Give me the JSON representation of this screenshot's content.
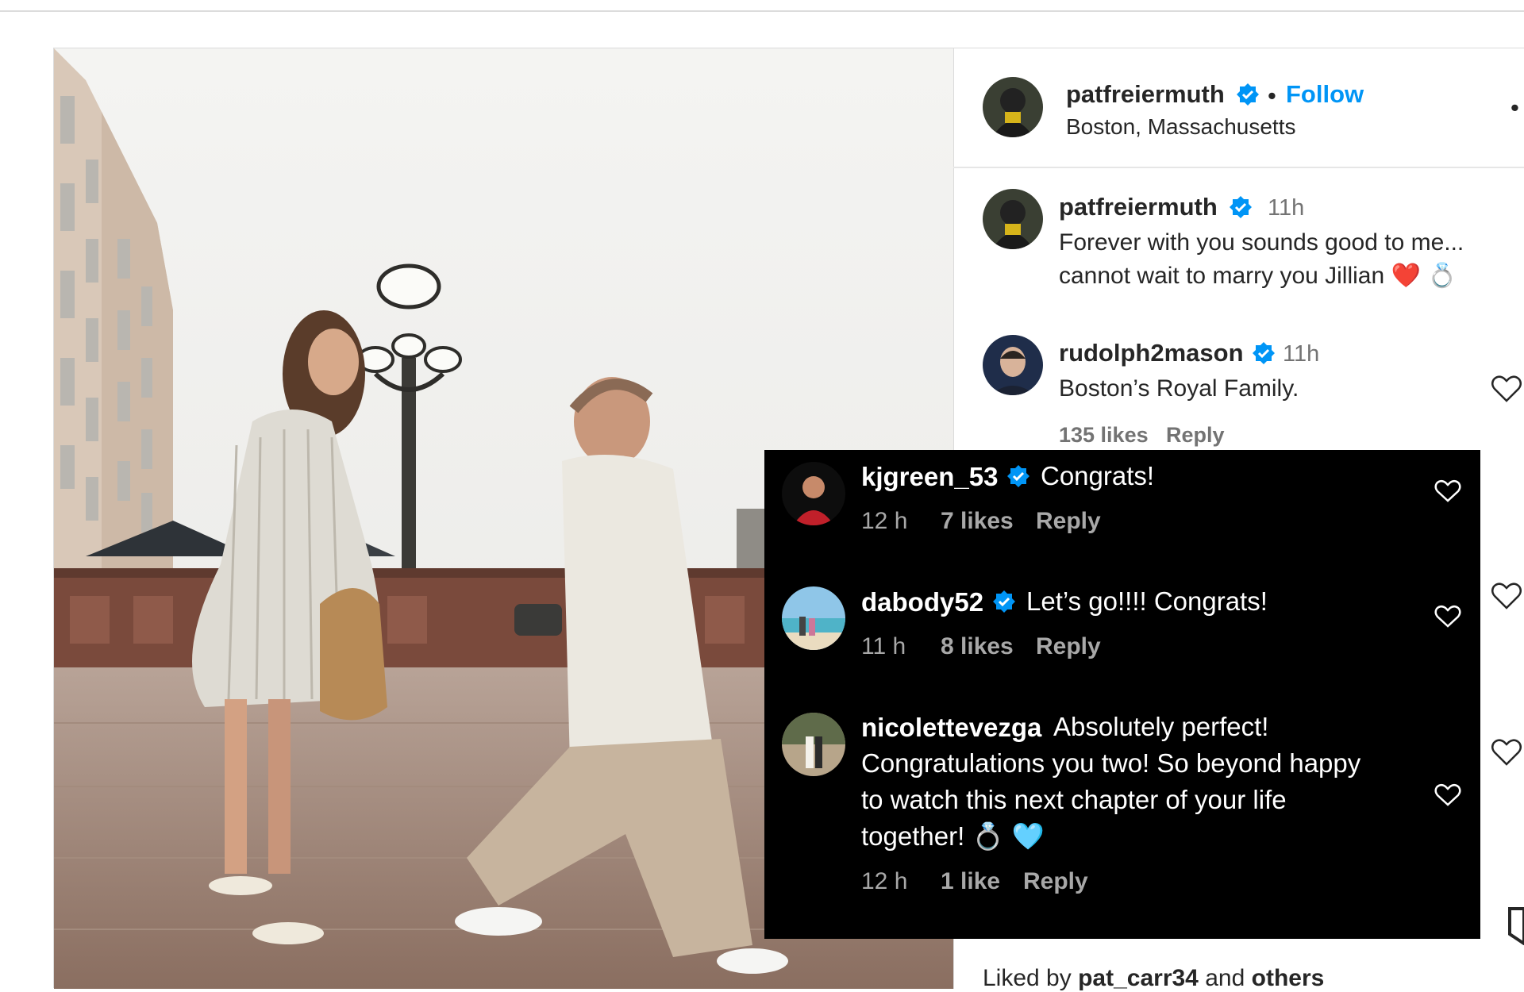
{
  "post": {
    "author": "patfreiermuth",
    "location": "Boston, Massachusetts",
    "follow_label": "Follow",
    "separator": "•",
    "menu_glyph": "•",
    "caption": {
      "username": "patfreiermuth",
      "time": "11h",
      "line1": "Forever with you sounds good to me...",
      "line2": "cannot wait to marry you Jillian ❤️ 💍"
    }
  },
  "comments": [
    {
      "username": "rudolph2mason",
      "time": "11h",
      "text": "Boston’s Royal Family.",
      "likes": "135 likes",
      "reply": "Reply"
    }
  ],
  "overlay_comments": [
    {
      "username": "kjgreen_53",
      "text": "Congrats!",
      "time": "12 h",
      "likes": "7 likes",
      "reply": "Reply"
    },
    {
      "username": "dabody52",
      "text": "Let’s go!!!! Congrats!",
      "time": "11 h",
      "likes": "8 likes",
      "reply": "Reply"
    },
    {
      "username": "nicolettevezga",
      "text_line1": "Absolutely perfect!",
      "text_line2": "Congratulations you two! So beyond happy",
      "text_line3": "to watch this next chapter of your life",
      "text_line4": "together! 💍 🩵",
      "time": "12 h",
      "likes": "1 like",
      "reply": "Reply"
    }
  ],
  "liked_by": {
    "prefix": "Liked by",
    "user": "pat_carr34",
    "middle": "and",
    "others": "others"
  },
  "icons": [
    "verified-badge-icon",
    "heart-icon",
    "more-options-icon",
    "bookmark-icon"
  ],
  "colors": {
    "link_blue": "#0095f6",
    "verified_blue": "#0095f6",
    "overlay_bg": "#000000",
    "text_dark": "#262626",
    "muted": "#737373"
  }
}
